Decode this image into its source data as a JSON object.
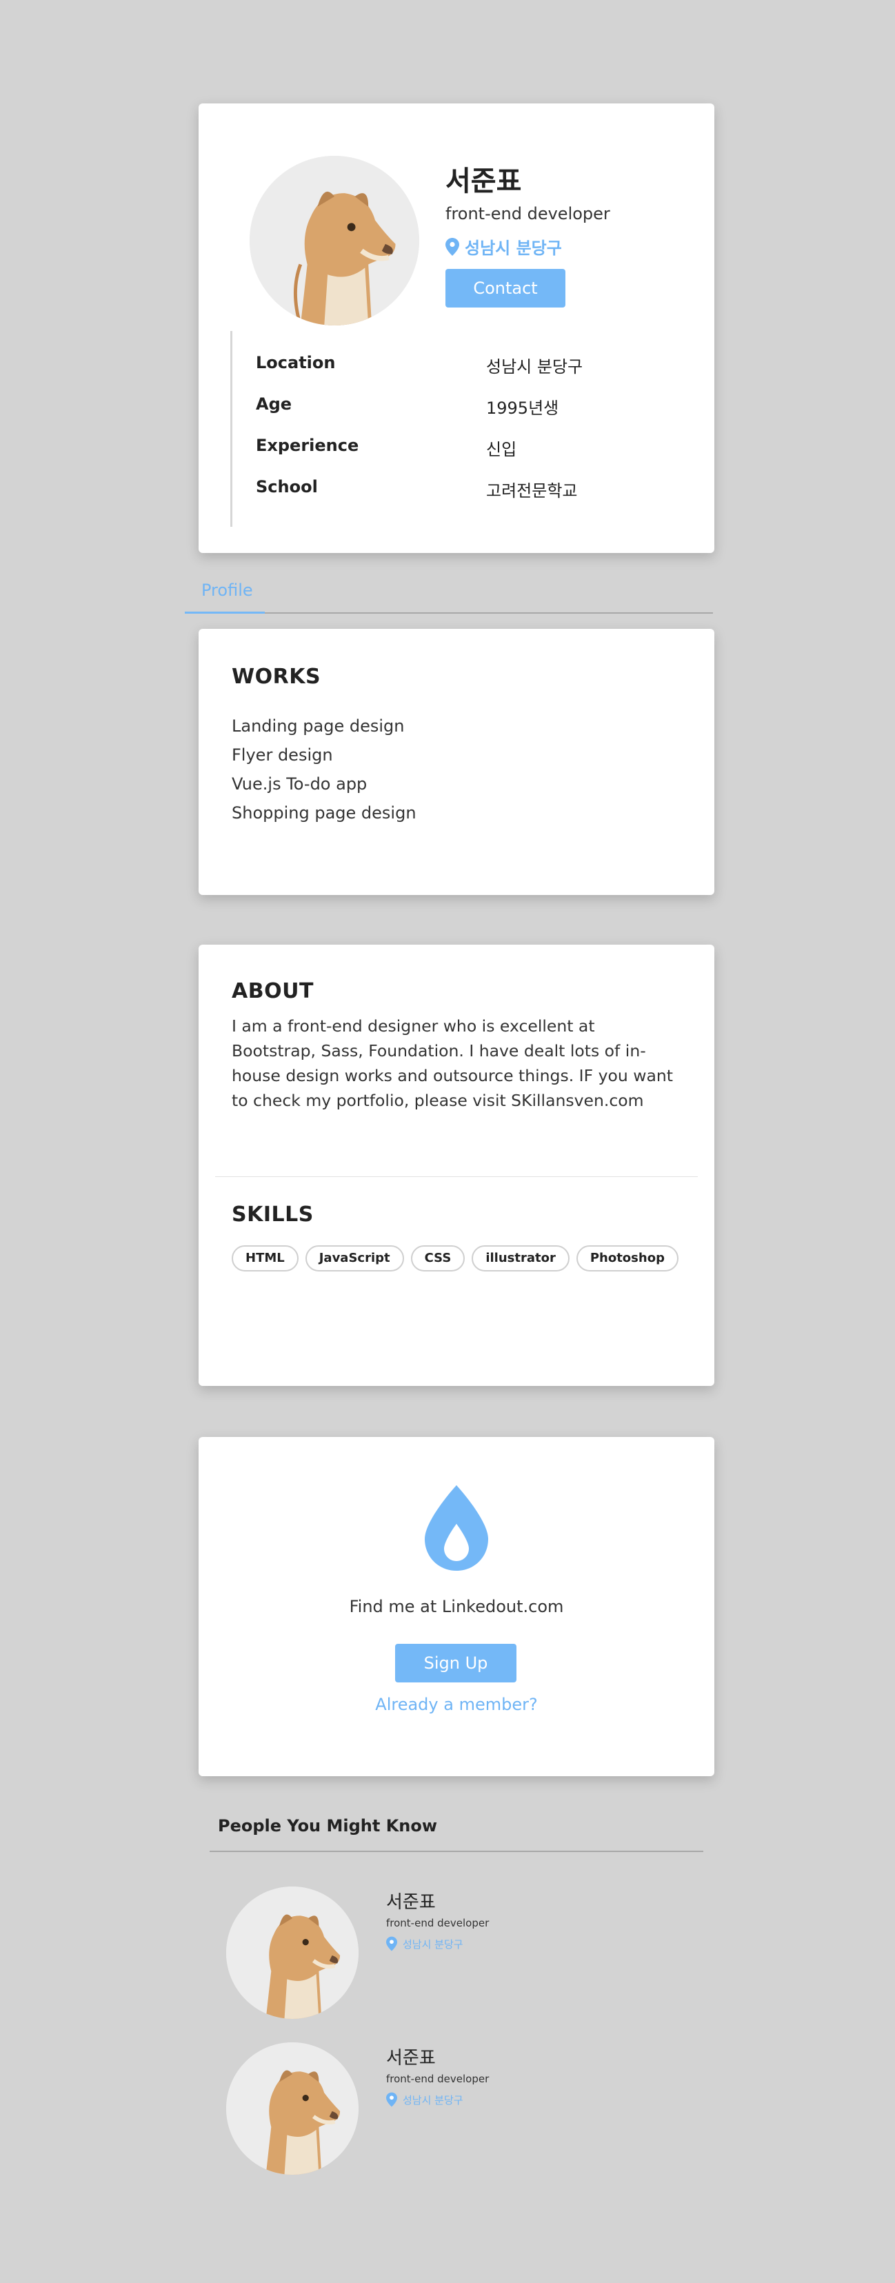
{
  "profile": {
    "name": "서준표",
    "role": "front-end developer",
    "location": "성남시 분당구",
    "contact_label": "Contact",
    "info": [
      {
        "key": "Location",
        "value": "성남시 분당구"
      },
      {
        "key": "Age",
        "value": "1995년생"
      },
      {
        "key": "Experience",
        "value": "신입"
      },
      {
        "key": "School",
        "value": "고려전문학교"
      }
    ]
  },
  "tabs": {
    "profile_label": "Profile"
  },
  "works": {
    "title": "WORKS",
    "items": [
      "Landing page design",
      "Flyer design",
      "Vue.js To-do app",
      "Shopping page design"
    ]
  },
  "about": {
    "title": "ABOUT",
    "text": "I am a front-end designer who is excellent at Bootstrap, Sass, Foundation. I have dealt lots of in-house design works and outsource things. IF you want to check my portfolio, please visit SKillansven.com"
  },
  "skills": {
    "title": "SKILLS",
    "items": [
      "HTML",
      "JavaScript",
      "CSS",
      "illustrator",
      "Photoshop"
    ]
  },
  "signup": {
    "icon": "water-drop-icon",
    "find_text": "Find me at Linkedout.com",
    "signup_label": "Sign Up",
    "member_link": "Already a member?"
  },
  "people": {
    "title": "People You Might Know",
    "items": [
      {
        "name": "서준표",
        "role": "front-end developer",
        "location": "성남시 분당구"
      },
      {
        "name": "서준표",
        "role": "front-end developer",
        "location": "성남시 분당구"
      }
    ]
  },
  "colors": {
    "accent": "#74b8f7",
    "background": "#d3d3d3",
    "card": "#ffffff"
  }
}
